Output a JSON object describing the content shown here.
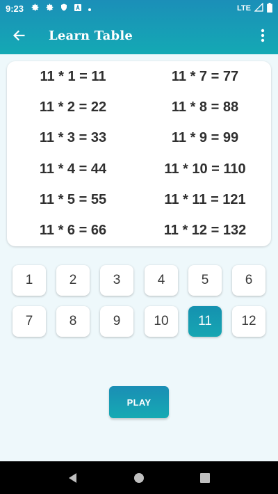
{
  "status_bar": {
    "time": "9:23",
    "network": "LTE"
  },
  "app_bar": {
    "title": "Learn Table"
  },
  "table": {
    "left": [
      "11 * 1 = 11",
      "11 * 2 = 22",
      "11 * 3 = 33",
      "11 * 4 = 44",
      "11 * 5 = 55",
      "11 * 6 = 66"
    ],
    "right": [
      "11 * 7 = 77",
      "11 * 8 = 88",
      "11 * 9 = 99",
      "11 * 10 = 110",
      "11 * 11 = 121",
      "11 * 12 = 132"
    ]
  },
  "numbers": [
    "1",
    "2",
    "3",
    "4",
    "5",
    "6",
    "7",
    "8",
    "9",
    "10",
    "11",
    "12"
  ],
  "selected_number": "11",
  "play_label": "PLAY",
  "colors": {
    "accent": "#16a6b2",
    "header": "#1b8fb8",
    "background": "#eef8fb"
  },
  "icons": {
    "back": "arrow-left-icon",
    "menu": "more-vertical-icon",
    "nav_back": "triangle-back-icon",
    "nav_home": "circle-home-icon",
    "nav_recent": "square-recents-icon"
  }
}
